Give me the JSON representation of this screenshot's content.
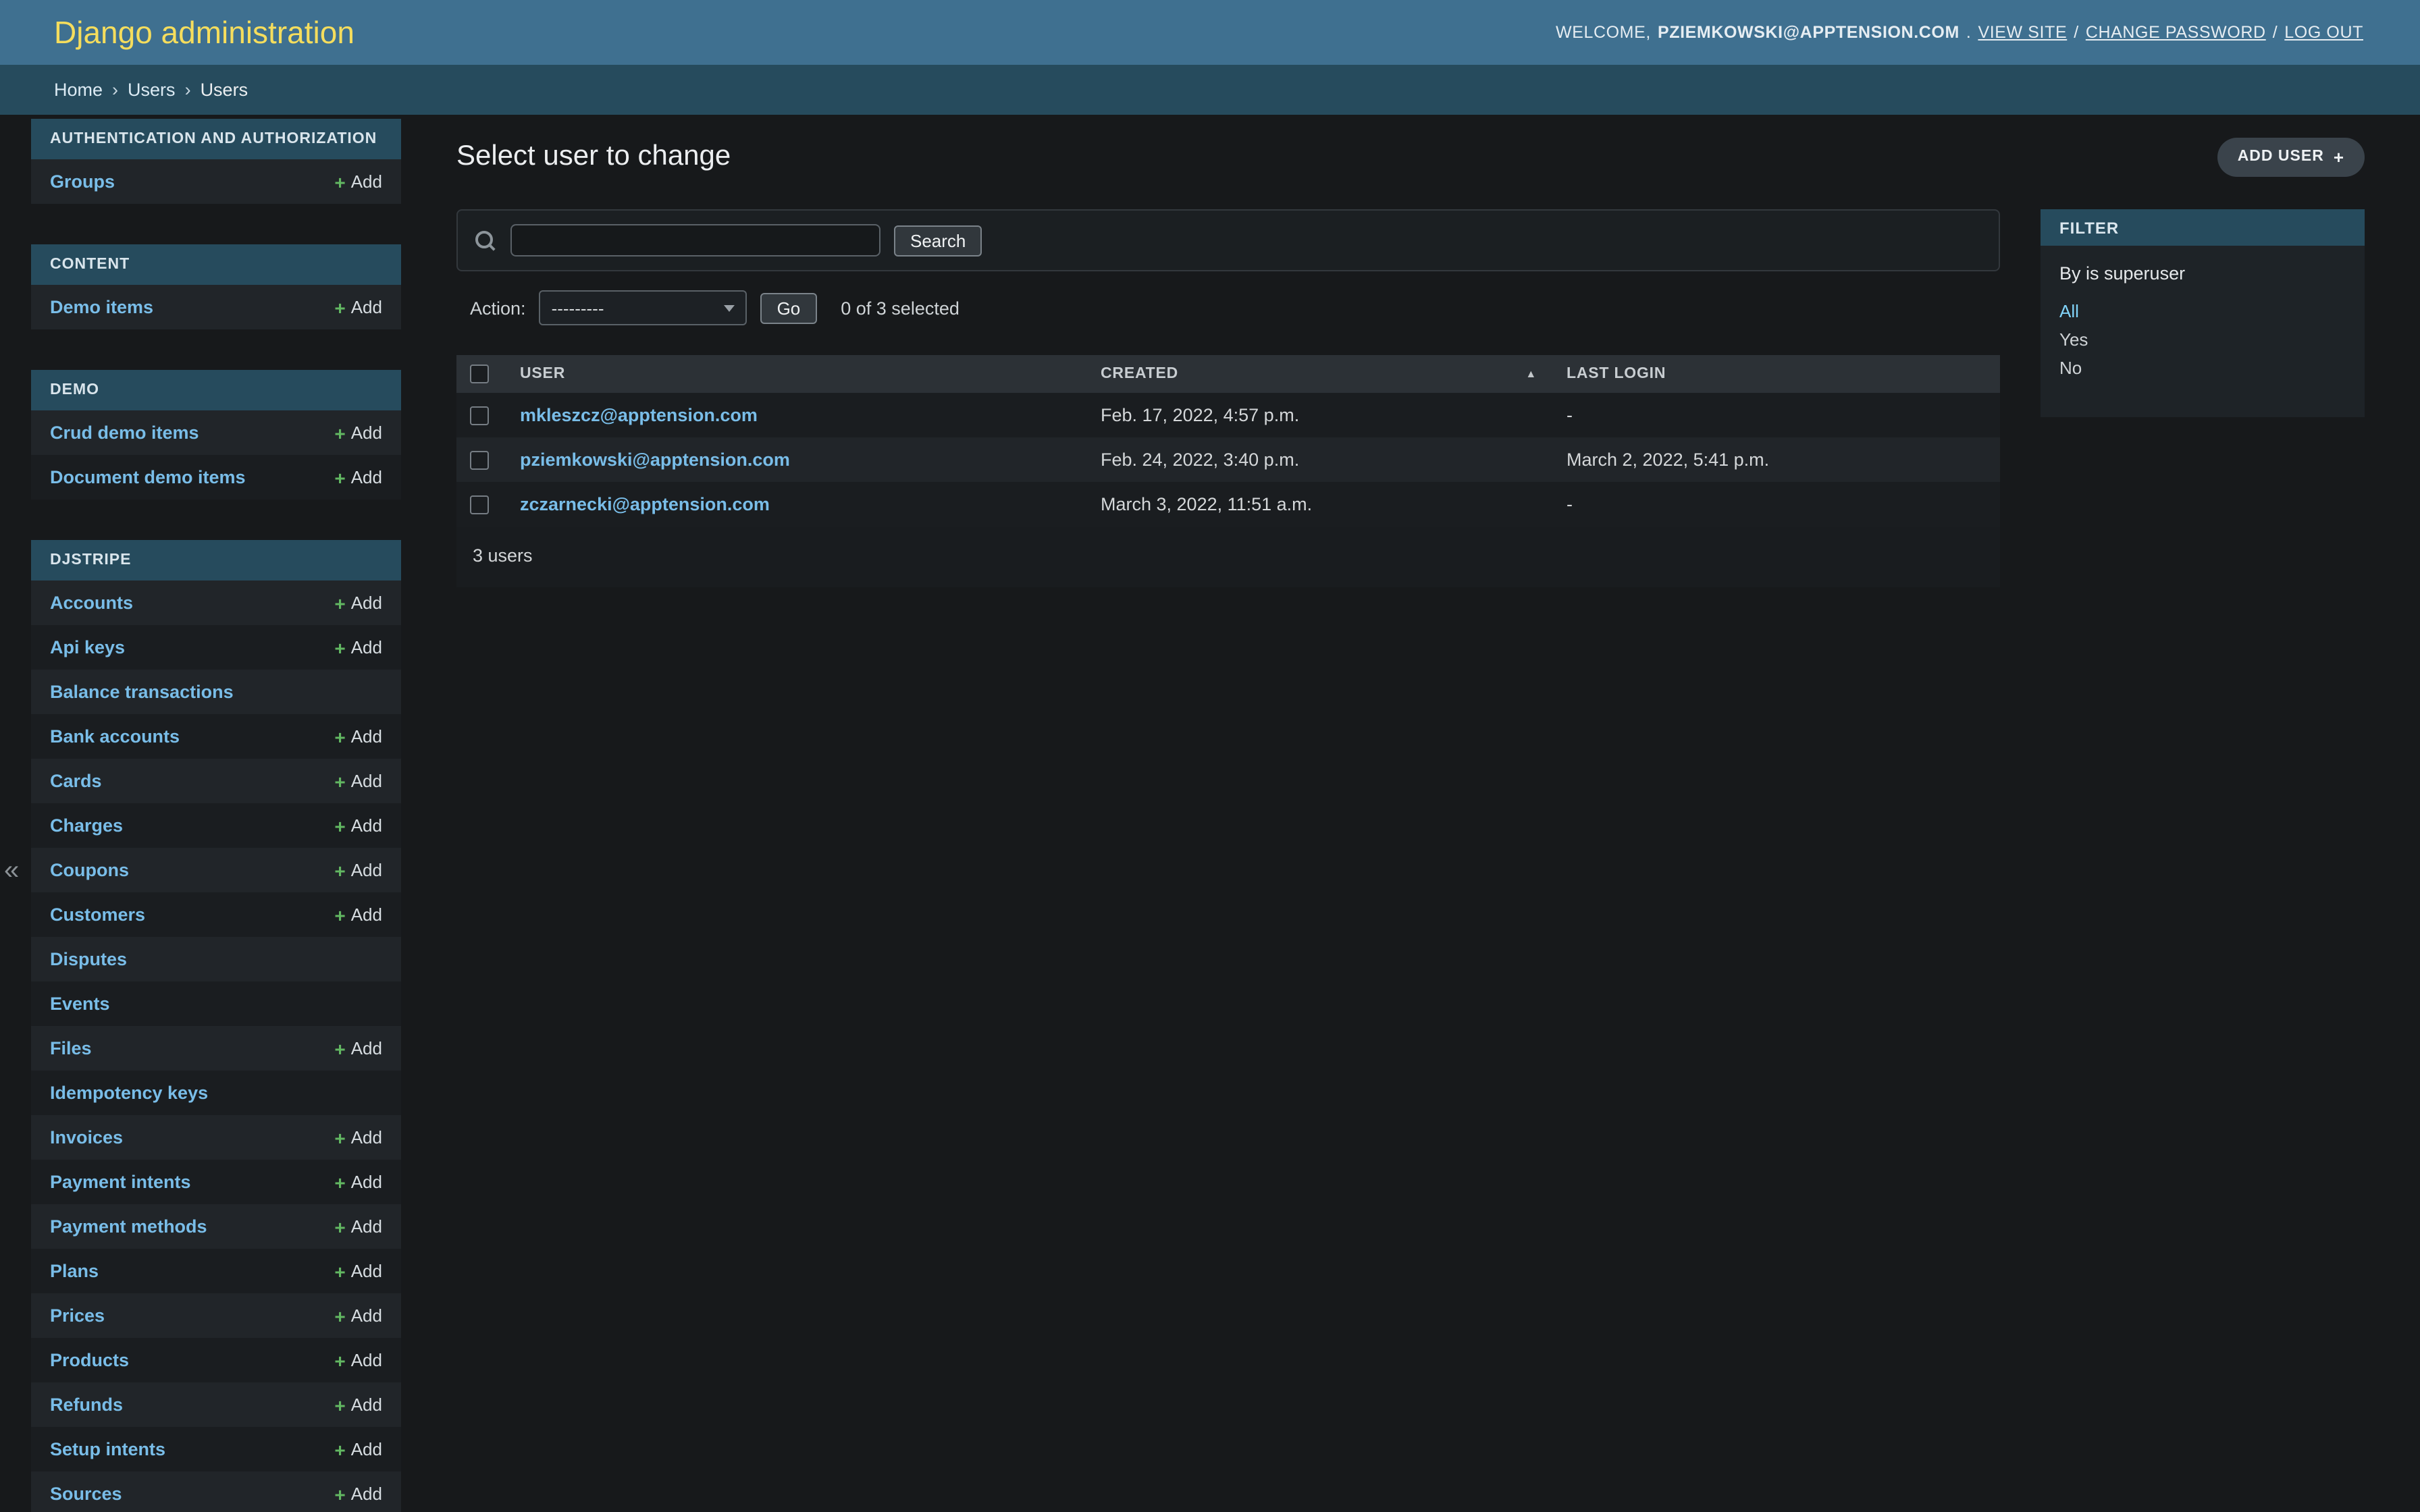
{
  "icons": {
    "plus": "+",
    "sort_asc": "▲",
    "collapse": "«"
  },
  "header": {
    "site_title": "Django administration",
    "welcome_prefix": "WELCOME,",
    "username": "PZIEMKOWSKI@APPTENSION.COM",
    "period": ".",
    "view_site": "VIEW SITE",
    "separator": "/",
    "change_password": "CHANGE PASSWORD",
    "log_out": "LOG OUT"
  },
  "breadcrumbs": {
    "home": "Home",
    "users_link": "Users",
    "current": "Users",
    "separator": "›"
  },
  "sidebar": {
    "add_label": "Add",
    "sections": [
      {
        "title": "AUTHENTICATION AND AUTHORIZATION",
        "items": [
          {
            "label": "Groups"
          }
        ]
      },
      {
        "title": "CONTENT",
        "items": [
          {
            "label": "Demo items"
          }
        ]
      },
      {
        "title": "DEMO",
        "items": [
          {
            "label": "Crud demo items"
          },
          {
            "label": "Document demo items"
          }
        ]
      },
      {
        "title": "DJSTRIPE",
        "items": [
          {
            "label": "Accounts"
          },
          {
            "label": "Api keys"
          },
          {
            "label": "Balance transactions"
          },
          {
            "label": "Bank accounts"
          },
          {
            "label": "Cards"
          },
          {
            "label": "Charges"
          },
          {
            "label": "Coupons"
          },
          {
            "label": "Customers"
          },
          {
            "label": "Disputes"
          },
          {
            "label": "Events"
          },
          {
            "label": "Files"
          },
          {
            "label": "Idempotency keys"
          },
          {
            "label": "Invoices"
          },
          {
            "label": "Payment intents"
          },
          {
            "label": "Payment methods"
          },
          {
            "label": "Plans"
          },
          {
            "label": "Prices"
          },
          {
            "label": "Products"
          },
          {
            "label": "Refunds"
          },
          {
            "label": "Setup intents"
          },
          {
            "label": "Sources"
          }
        ]
      }
    ]
  },
  "main": {
    "page_title": "Select user to change",
    "add_user_button": "ADD USER",
    "search": {
      "value": "",
      "button": "Search"
    },
    "actions": {
      "label": "Action:",
      "selected_option": "---------",
      "go_button": "Go",
      "counter": "0 of 3 selected"
    },
    "table": {
      "columns": [
        "USER",
        "CREATED",
        "LAST LOGIN"
      ],
      "rows": [
        {
          "user": "mkleszcz@apptension.com",
          "created": "Feb. 17, 2022, 4:57 p.m.",
          "last_login": "-"
        },
        {
          "user": "pziemkowski@apptension.com",
          "created": "Feb. 24, 2022, 3:40 p.m.",
          "last_login": "March 2, 2022, 5:41 p.m."
        },
        {
          "user": "zczarnecki@apptension.com",
          "created": "March 3, 2022, 11:51 a.m.",
          "last_login": "-"
        }
      ]
    },
    "result_count": "3 users"
  },
  "filter": {
    "title": "FILTER",
    "group_title": "By is superuser",
    "options": [
      {
        "label": "All"
      },
      {
        "label": "Yes"
      },
      {
        "label": "No"
      }
    ]
  }
}
